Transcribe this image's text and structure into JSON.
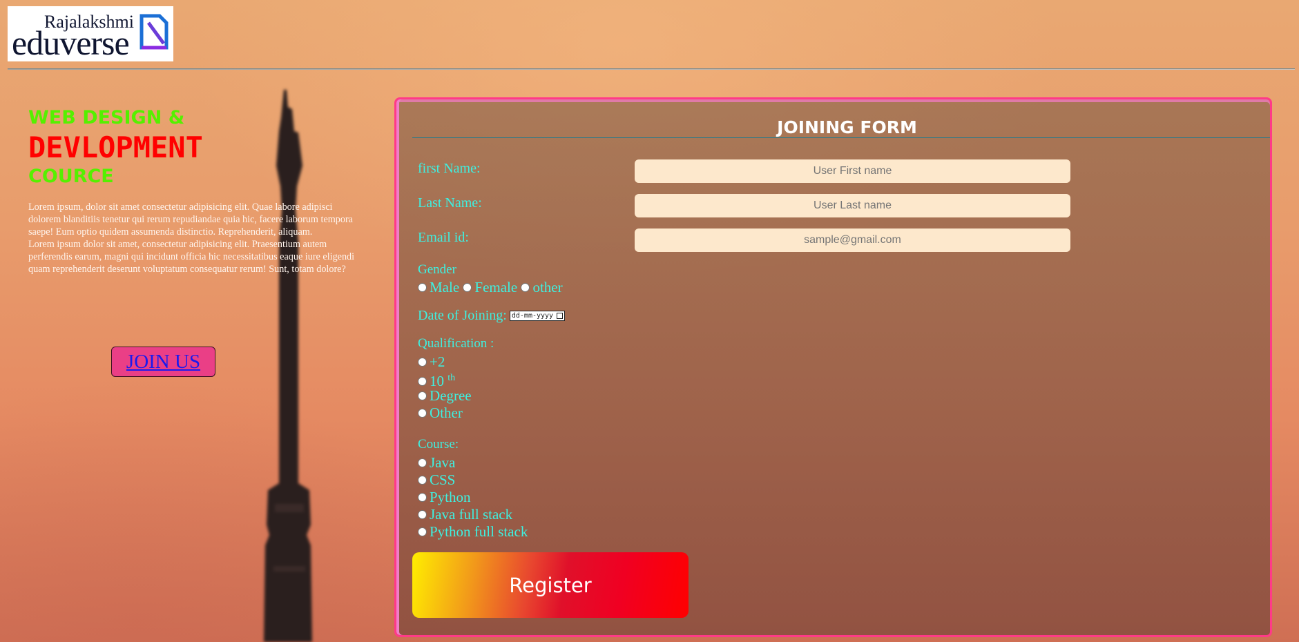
{
  "logo": {
    "line1": "Rajalakshmi",
    "line2": "eduverse"
  },
  "hero": {
    "title_line1": "WEB DESIGN &",
    "title_line2": "DEVLOPMENT",
    "title_line3": "COURCE",
    "paragraph1": "Lorem ipsum, dolor sit amet consectetur adipisicing elit. Quae labore adipisci dolorem blanditiis tenetur qui rerum repudiandae quia hic, facere laborum tempora saepe! Eum optio quidem assumenda distinctio. Reprehenderit, aliquam.",
    "paragraph2": "Lorem ipsum dolor sit amet, consectetur adipisicing elit. Praesentium autem perferendis earum, magni qui incidunt officia hic necessitatibus eaque iure eligendi quam reprehenderit deserunt voluptatum consequatur rerum! Sunt, totam dolore?",
    "join_label": "JOIN US"
  },
  "form": {
    "title": "JOINING FORM",
    "first_name_label": "first Name:",
    "first_name_placeholder": "User First name",
    "last_name_label": "Last Name:",
    "last_name_placeholder": "User Last name",
    "email_label": "Email id:",
    "email_placeholder": "sample@gmail.com",
    "gender_label": "Gender",
    "gender_options": [
      "Male",
      "Female",
      "other"
    ],
    "doj_label": "Date of Joining:",
    "doj_placeholder": "dd-mm-yyyy",
    "qualification_label": "Qualification :",
    "qualification_options": [
      "+2",
      "10",
      "Degree",
      "Other"
    ],
    "qualification_sup": "th",
    "course_label": "Course:",
    "course_options": [
      "Java",
      "CSS",
      "Python",
      "Java full stack",
      "Python full stack"
    ],
    "register_label": "Register"
  },
  "colors": {
    "label_cyan": "#3ef0e0",
    "title_green": "#55f000",
    "title_red": "#ff0000",
    "join_pink": "#ea3f86",
    "form_border": "#ff3a88",
    "input_bg": "#fde8cc"
  }
}
